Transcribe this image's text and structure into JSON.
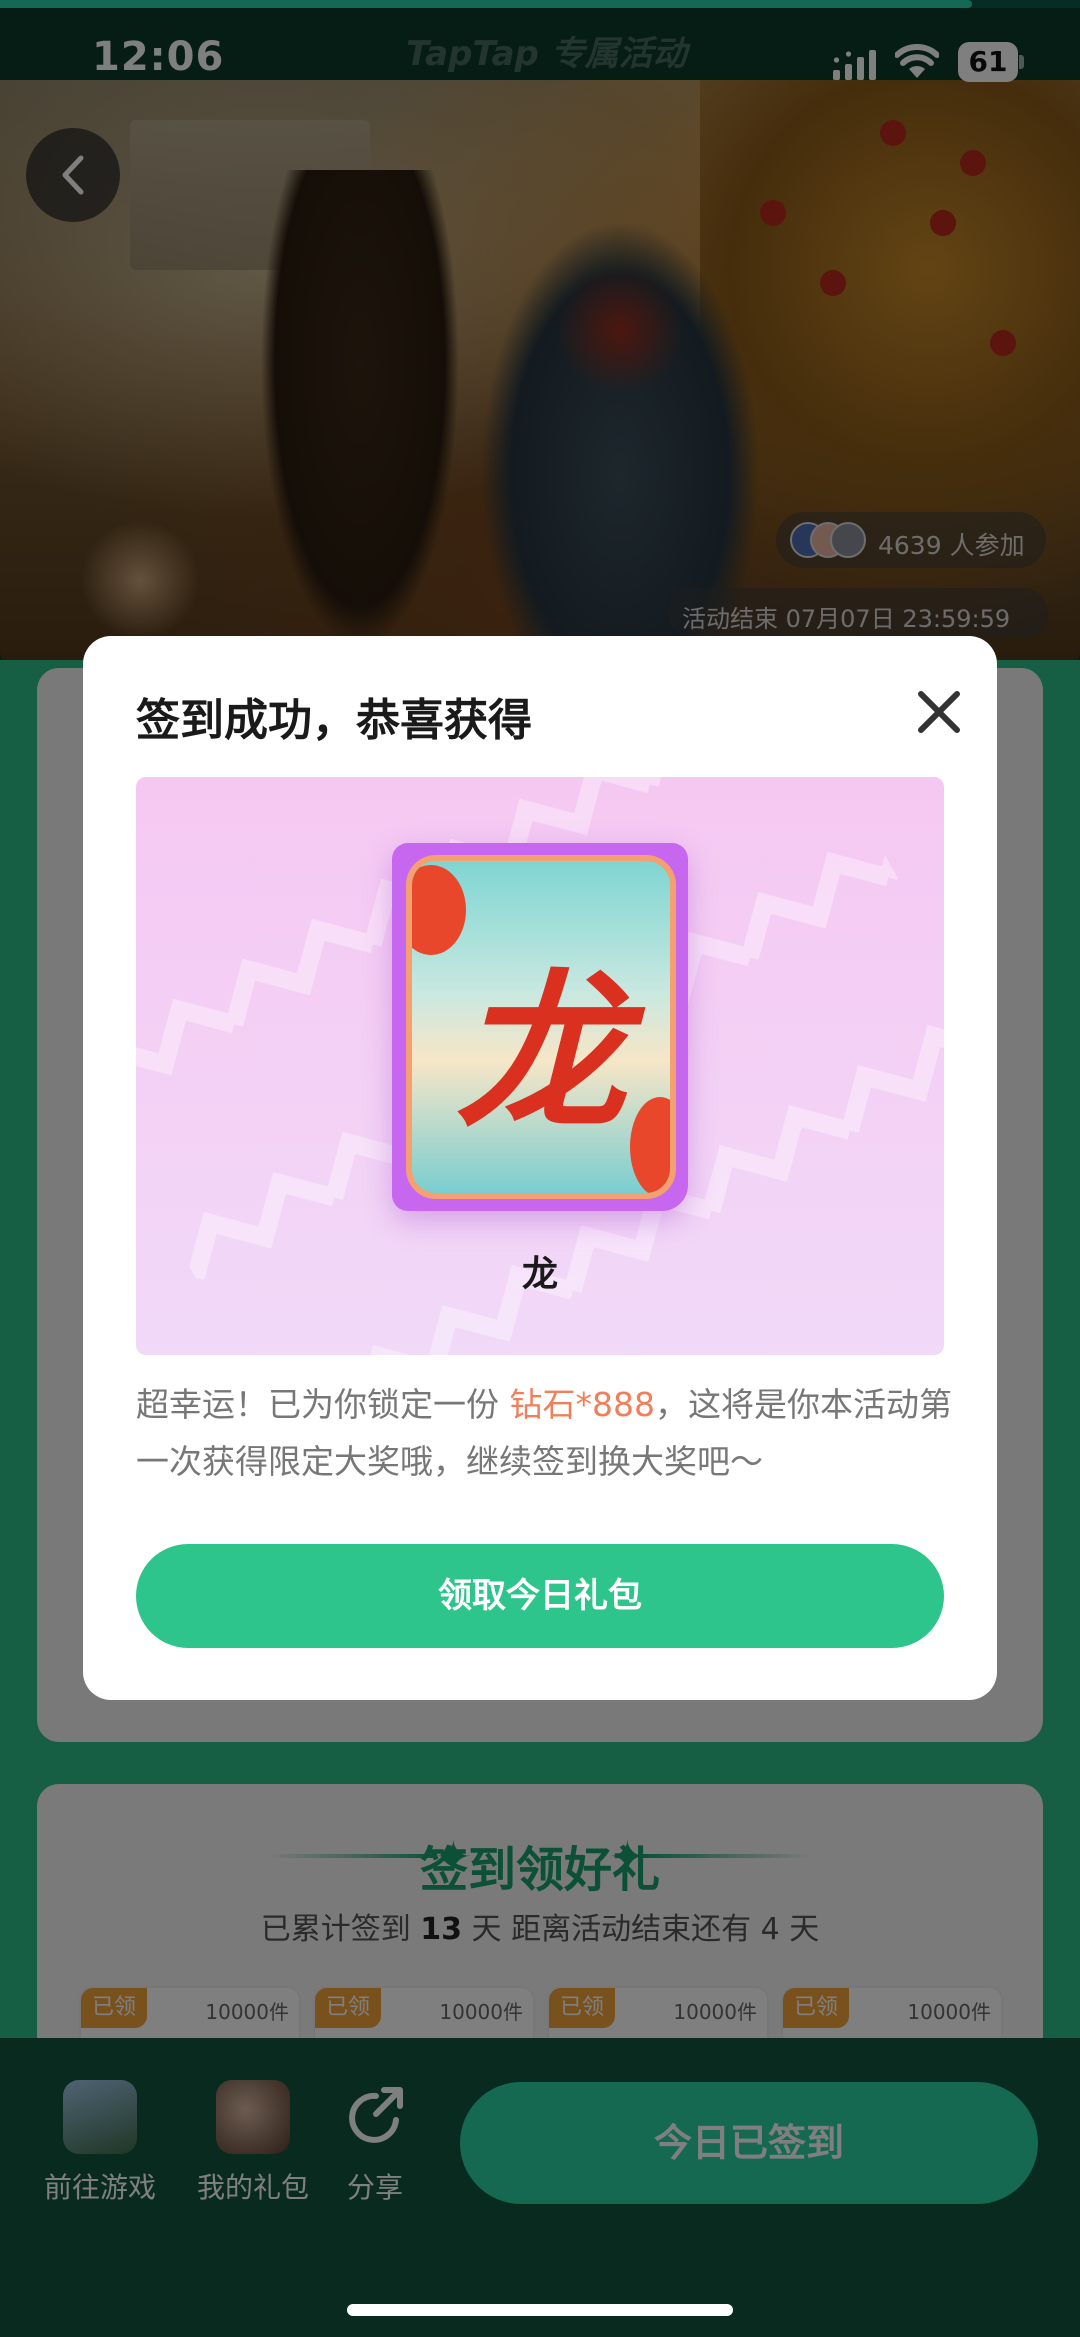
{
  "progress": {
    "fraction": 0.9
  },
  "status_bar": {
    "time": "12:06",
    "brand": "TapTap 专属活动",
    "battery": "61"
  },
  "hero": {
    "participants": "4639 人参加",
    "end_time": "活动结束 07月07日 23:59:59"
  },
  "dialog": {
    "title": "签到成功，恭喜获得",
    "reward_card_glyph": "龙",
    "reward_name": "龙",
    "message_before": "超幸运！已为你锁定一份 ",
    "message_highlight": "钻石*888",
    "message_after": "，这将是你本活动第一次获得限定大奖哦，继续签到换大奖吧～",
    "claim_button": "领取今日礼包",
    "highlight_color": "#f0805c",
    "button_color": "#2ec58d"
  },
  "signin": {
    "title": "签到领好礼",
    "summary_prefix": "已累计签到 ",
    "days_signed": "13",
    "summary_middle": " 天  距离活动结束还有 ",
    "days_left": "4",
    "summary_suffix": " 天",
    "tiles": [
      {
        "badge": "已领",
        "count": "10000件"
      },
      {
        "badge": "已领",
        "count": "10000件"
      },
      {
        "badge": "已领",
        "count": "10000件"
      },
      {
        "badge": "已领",
        "count": "10000件"
      }
    ]
  },
  "bottom_nav": {
    "go_game": "前往游戏",
    "my_gifts": "我的礼包",
    "share": "分享",
    "checkin_button": "今日已签到"
  },
  "icons": {
    "back": "chevron-left-icon",
    "close": "close-icon",
    "share": "share-icon"
  }
}
